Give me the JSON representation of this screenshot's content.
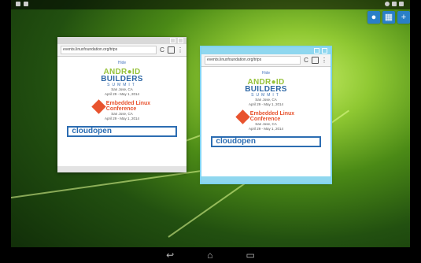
{
  "status_bar": {
    "left_icons": [
      "notification-icon",
      "notification-icon"
    ],
    "right_icons": [
      "bluetooth-icon",
      "wifi-icon",
      "battery-icon"
    ]
  },
  "top_buttons": [
    "user-icon",
    "grid-icon",
    "add-icon"
  ],
  "windows": [
    {
      "url": "events.linuxfoundation.org/trips",
      "hide": "Hide",
      "android": "ANDR",
      "android_o": "●",
      "android_id": "ID",
      "builders": "BUILDERS",
      "summit": "SUMMIT",
      "location1": "San Jose, CA",
      "dates1": "April 29 - May 1, 2014",
      "elc_line1": "Embedded Linux",
      "elc_line2": "Conference",
      "location2": "San Jose, CA",
      "dates2": "April 29 - May 1, 2014",
      "cloud": "cloudopen"
    },
    {
      "url": "events.linuxfoundation.org/trips",
      "hide": "Hide",
      "android": "ANDR",
      "android_o": "●",
      "android_id": "ID",
      "builders": "BUILDERS",
      "summit": "SUMMIT",
      "location1": "San Jose, CA",
      "dates1": "April 29 - May 1, 2014",
      "elc_line1": "Embedded Linux",
      "elc_line2": "Conference",
      "location2": "San Jose, CA",
      "dates2": "April 29 - May 1, 2014",
      "cloud": "cloudopen"
    }
  ],
  "nav": [
    "back-icon",
    "home-icon",
    "recents-icon"
  ]
}
